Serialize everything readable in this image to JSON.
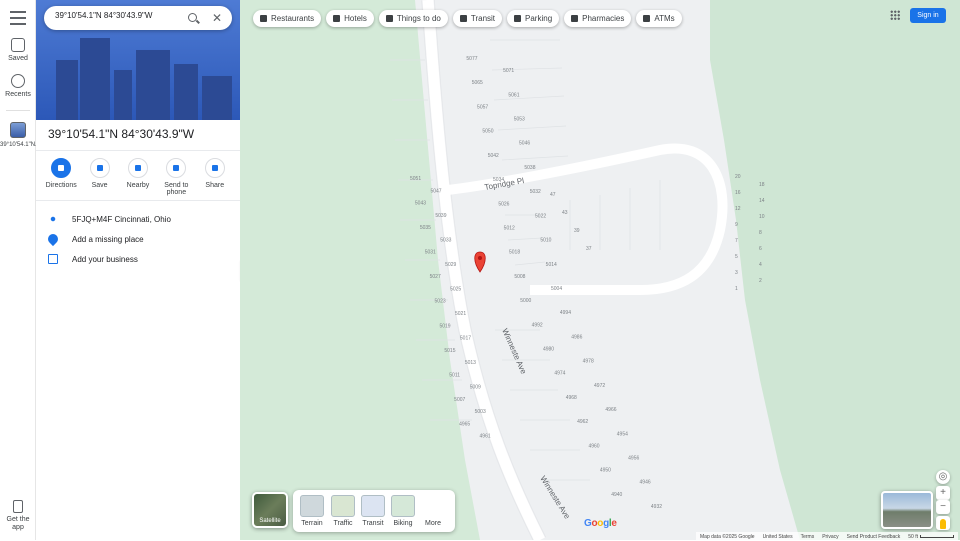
{
  "search": {
    "value": "39°10'54.1\"N 84°30'43.9\"W"
  },
  "rail": {
    "saved": "Saved",
    "recents": "Recents",
    "current": "39°10'54.1\"N...",
    "get_app": "Get the app"
  },
  "place": {
    "title": "39°10'54.1\"N 84°30'43.9\"W",
    "actions": [
      "Directions",
      "Save",
      "Nearby",
      "Send to phone",
      "Share"
    ],
    "plus_code": "5FJQ+M4F Cincinnati, Ohio",
    "add_place": "Add a missing place",
    "add_business": "Add your business"
  },
  "chips": [
    "Restaurants",
    "Hotels",
    "Things to do",
    "Transit",
    "Parking",
    "Pharmacies",
    "ATMs"
  ],
  "signin": "Sign in",
  "layers": {
    "satellite": "Satellite",
    "items": [
      "Terrain",
      "Traffic",
      "Transit",
      "Biking",
      "More"
    ]
  },
  "map": {
    "street_1": "Winneste Ave",
    "street_2": "Topridge Pl",
    "house_numbers_right": [
      "5077",
      "5071",
      "5065",
      "5061",
      "5057",
      "5053",
      "5050",
      "5046",
      "5042",
      "5038",
      "5034",
      "5032",
      "5026",
      "5022",
      "5012",
      "5010",
      "5018",
      "5014",
      "5008",
      "5004",
      "5000",
      "4994",
      "4992",
      "4986",
      "4980",
      "4978",
      "4974",
      "4972",
      "4968",
      "4966",
      "4962",
      "4954",
      "4960",
      "4956",
      "4950",
      "4946",
      "4940",
      "4932"
    ],
    "house_numbers_left": [
      "5051",
      "5047",
      "5043",
      "5039",
      "5035",
      "5033",
      "5031",
      "5029",
      "5027",
      "5025",
      "5023",
      "5021",
      "5019",
      "5017",
      "5015",
      "5013",
      "5011",
      "5009",
      "5007",
      "5003",
      "4965",
      "4961"
    ],
    "topridge_numbers": [
      "47",
      "43",
      "39",
      "37",
      "20",
      "18",
      "16",
      "14",
      "12",
      "10",
      "9",
      "8",
      "7",
      "6",
      "5",
      "4",
      "3",
      "2",
      "1"
    ]
  },
  "footer": {
    "map_data": "Map data ©2025 Google",
    "country": "United States",
    "terms": "Terms",
    "privacy": "Privacy",
    "feedback": "Send Product Feedback",
    "scale": "50 ft"
  }
}
